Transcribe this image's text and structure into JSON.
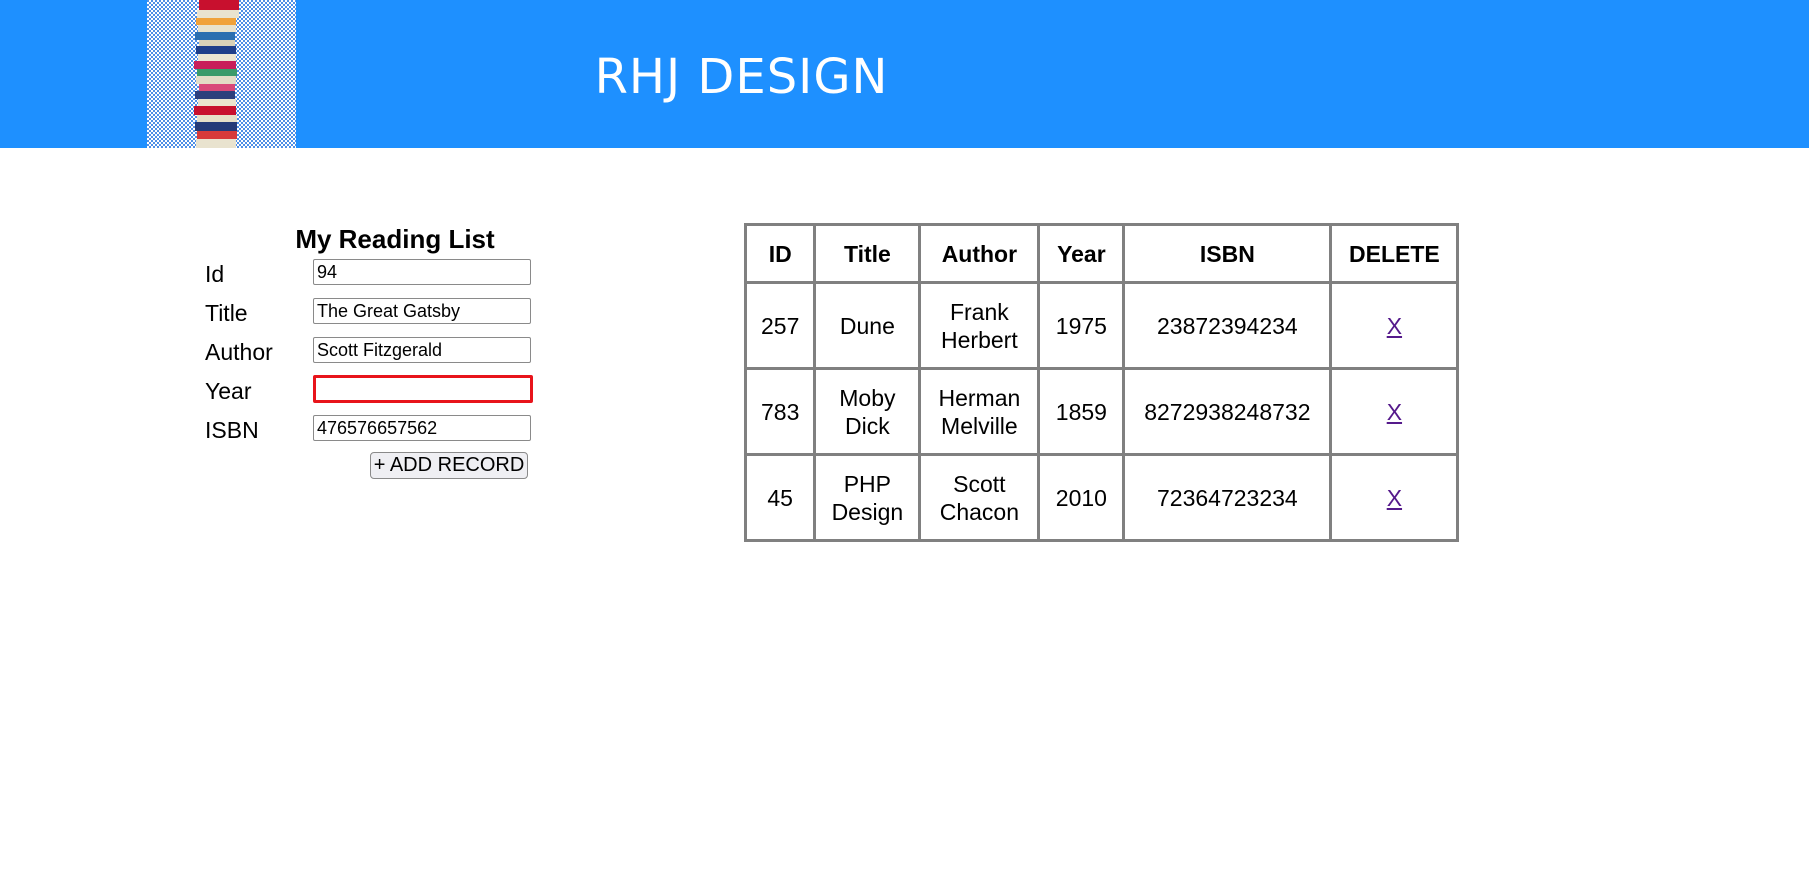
{
  "header": {
    "title": "RHJ DESIGN",
    "logo_icon": "book-stack-icon",
    "background": "#1e90ff"
  },
  "form": {
    "heading": "My Reading List",
    "fields": {
      "id": {
        "label": "Id",
        "value": "94"
      },
      "title": {
        "label": "Title",
        "value": "The Great Gatsby"
      },
      "author": {
        "label": "Author",
        "value": "Scott Fitzgerald"
      },
      "year": {
        "label": "Year",
        "value": "",
        "state": "error"
      },
      "isbn": {
        "label": "ISBN",
        "value": "476576657562"
      }
    },
    "add_button": "+ ADD RECORD"
  },
  "table": {
    "headers": [
      "ID",
      "Title",
      "Author",
      "Year",
      "ISBN",
      "DELETE"
    ],
    "rows": [
      {
        "id": "257",
        "title": "Dune",
        "author": "Frank Herbert",
        "year": "1975",
        "isbn": "23872394234",
        "delete": "X"
      },
      {
        "id": "783",
        "title": "Moby Dick",
        "author": "Herman Melville",
        "year": "1859",
        "isbn": "8272938248732",
        "delete": "X"
      },
      {
        "id": "45",
        "title": "PHP Design",
        "author": "Scott Chacon",
        "year": "2010",
        "isbn": "72364723234",
        "delete": "X"
      }
    ]
  },
  "colors": {
    "error_border": "#e8141b",
    "link": "#551a8b",
    "table_border": "#808080"
  }
}
